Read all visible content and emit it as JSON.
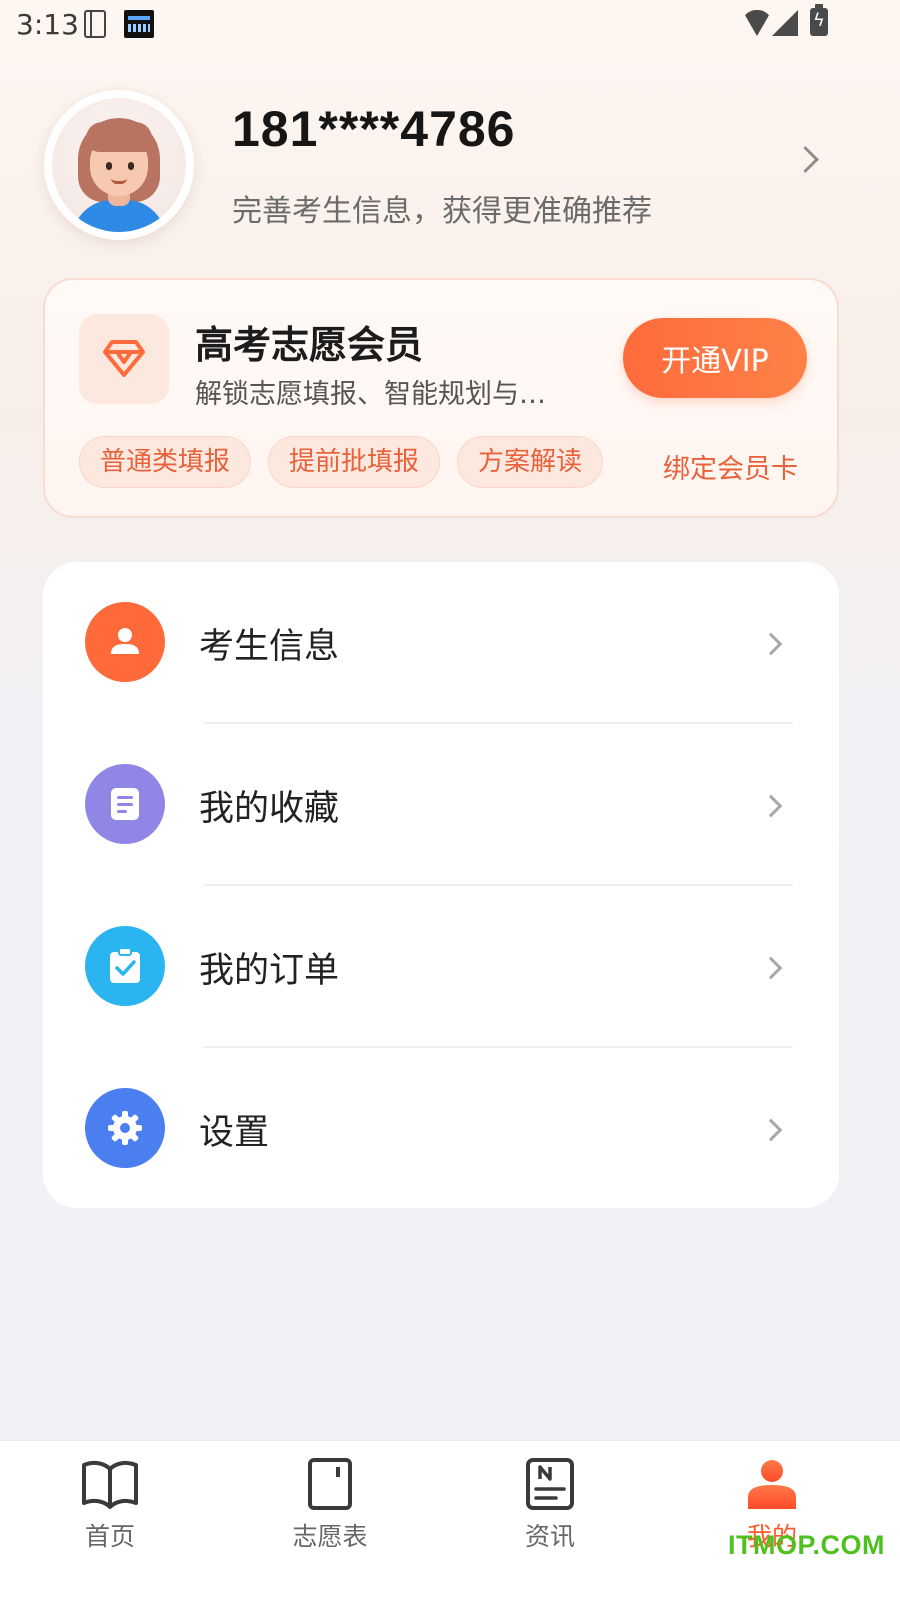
{
  "status_bar": {
    "time": "3:13"
  },
  "profile": {
    "phone": "181****4786",
    "tip": "完善考生信息，获得更准确推荐"
  },
  "vip": {
    "title": "高考志愿会员",
    "subtitle": "解锁志愿填报、智能规划与…",
    "button": "开通VIP",
    "tags": [
      "普通类填报",
      "提前批填报",
      "方案解读"
    ],
    "bind_card": "绑定会员卡",
    "accent_color": "#ff6b3c"
  },
  "menu": [
    {
      "label": "考生信息",
      "icon": "user-icon",
      "color": "#ff6a3a"
    },
    {
      "label": "我的收藏",
      "icon": "document-icon",
      "color": "#8f86e6"
    },
    {
      "label": "我的订单",
      "icon": "clipboard-check-icon",
      "color": "#2bb5f0"
    },
    {
      "label": "设置",
      "icon": "gear-icon",
      "color": "#4b7ff0"
    }
  ],
  "bottom_nav": [
    {
      "label": "首页",
      "icon": "book-icon",
      "active": false
    },
    {
      "label": "志愿表",
      "icon": "notebook-icon",
      "active": false
    },
    {
      "label": "资讯",
      "icon": "news-icon",
      "active": false
    },
    {
      "label": "我的",
      "icon": "profile-icon",
      "active": true
    }
  ],
  "watermark": "ITMOP.COM"
}
